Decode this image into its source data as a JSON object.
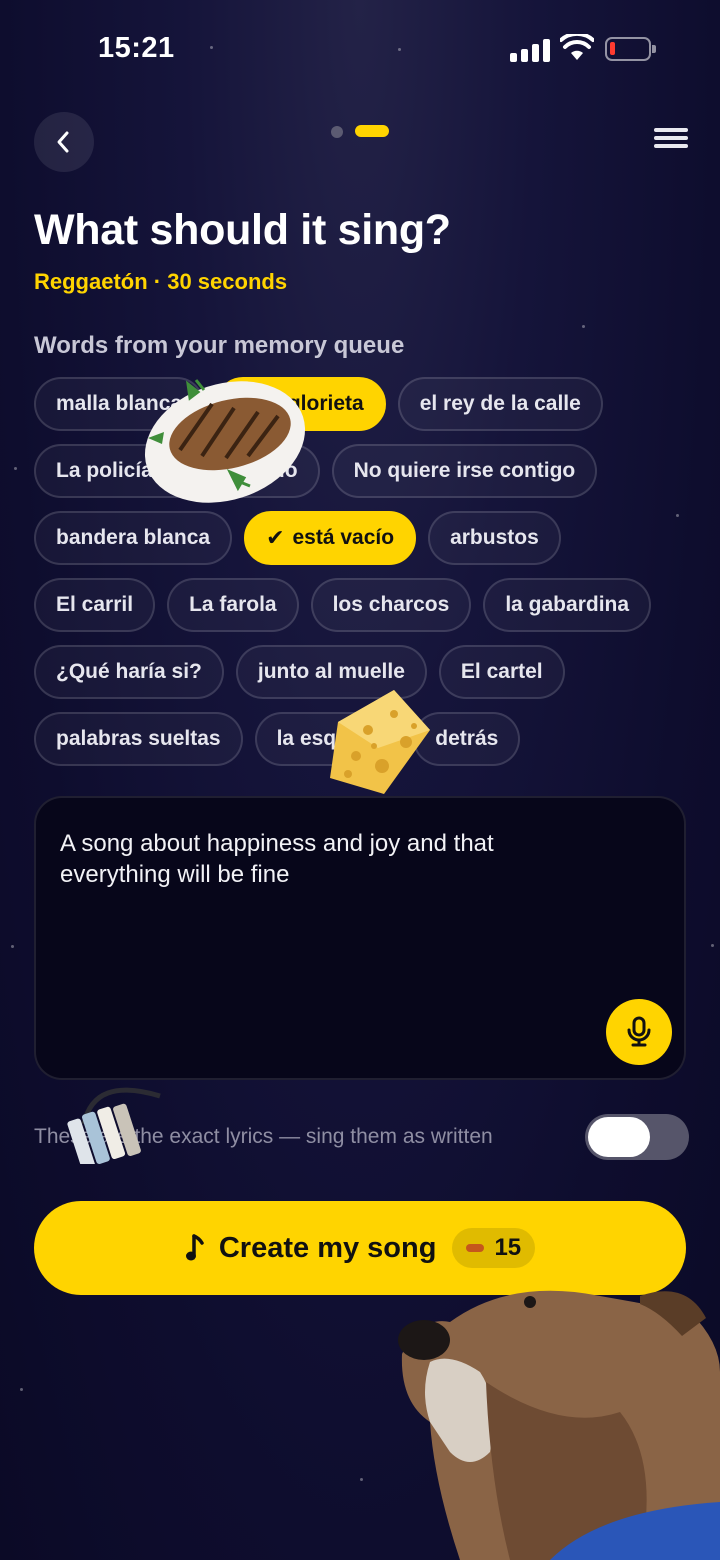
{
  "status_bar": {
    "time": "15:21"
  },
  "header": {
    "step_count": 2,
    "active_step": 2
  },
  "page": {
    "title": "What should it sing?",
    "subtitle": "Reggaetón · 30 seconds",
    "section_label": "Words from your memory queue"
  },
  "chips": [
    [
      {
        "label": "malla blanca",
        "selected": false
      },
      {
        "label": "la glorieta",
        "selected": true
      },
      {
        "label": "el rey de la calle",
        "selected": false
      }
    ],
    [
      {
        "label": "La policía vendrá rápido",
        "selected": false
      },
      {
        "label": "No quiere irse contigo",
        "selected": false
      }
    ],
    [
      {
        "label": "bandera blanca",
        "selected": false
      },
      {
        "label": "está vacío",
        "selected": true
      },
      {
        "label": "arbustos",
        "selected": false
      }
    ],
    [
      {
        "label": "El carril",
        "selected": false
      },
      {
        "label": "La farola",
        "selected": false
      },
      {
        "label": "los charcos",
        "selected": false
      },
      {
        "label": "la gabardina",
        "selected": false
      }
    ],
    [
      {
        "label": "¿Qué haría si?",
        "selected": false
      },
      {
        "label": "junto al muelle",
        "selected": false
      },
      {
        "label": "El cartel",
        "selected": false
      }
    ],
    [
      {
        "label": "palabras sueltas",
        "selected": false
      },
      {
        "label": "la esquina",
        "selected": false
      },
      {
        "label": "detrás",
        "selected": false
      }
    ]
  ],
  "prompt": {
    "value": "A song about happiness and joy and that everything will be fine"
  },
  "exact_lyrics": {
    "label": "These are the exact lyrics — sing them as written",
    "enabled": false
  },
  "create_button": {
    "label": "Create my song",
    "cost": "15"
  },
  "colors": {
    "accent": "#ffd400",
    "background": "#0e0d2e"
  },
  "icons": [
    "back-icon",
    "menu-icon",
    "check-icon",
    "mic-icon",
    "music-note-icon",
    "coin-icon"
  ]
}
